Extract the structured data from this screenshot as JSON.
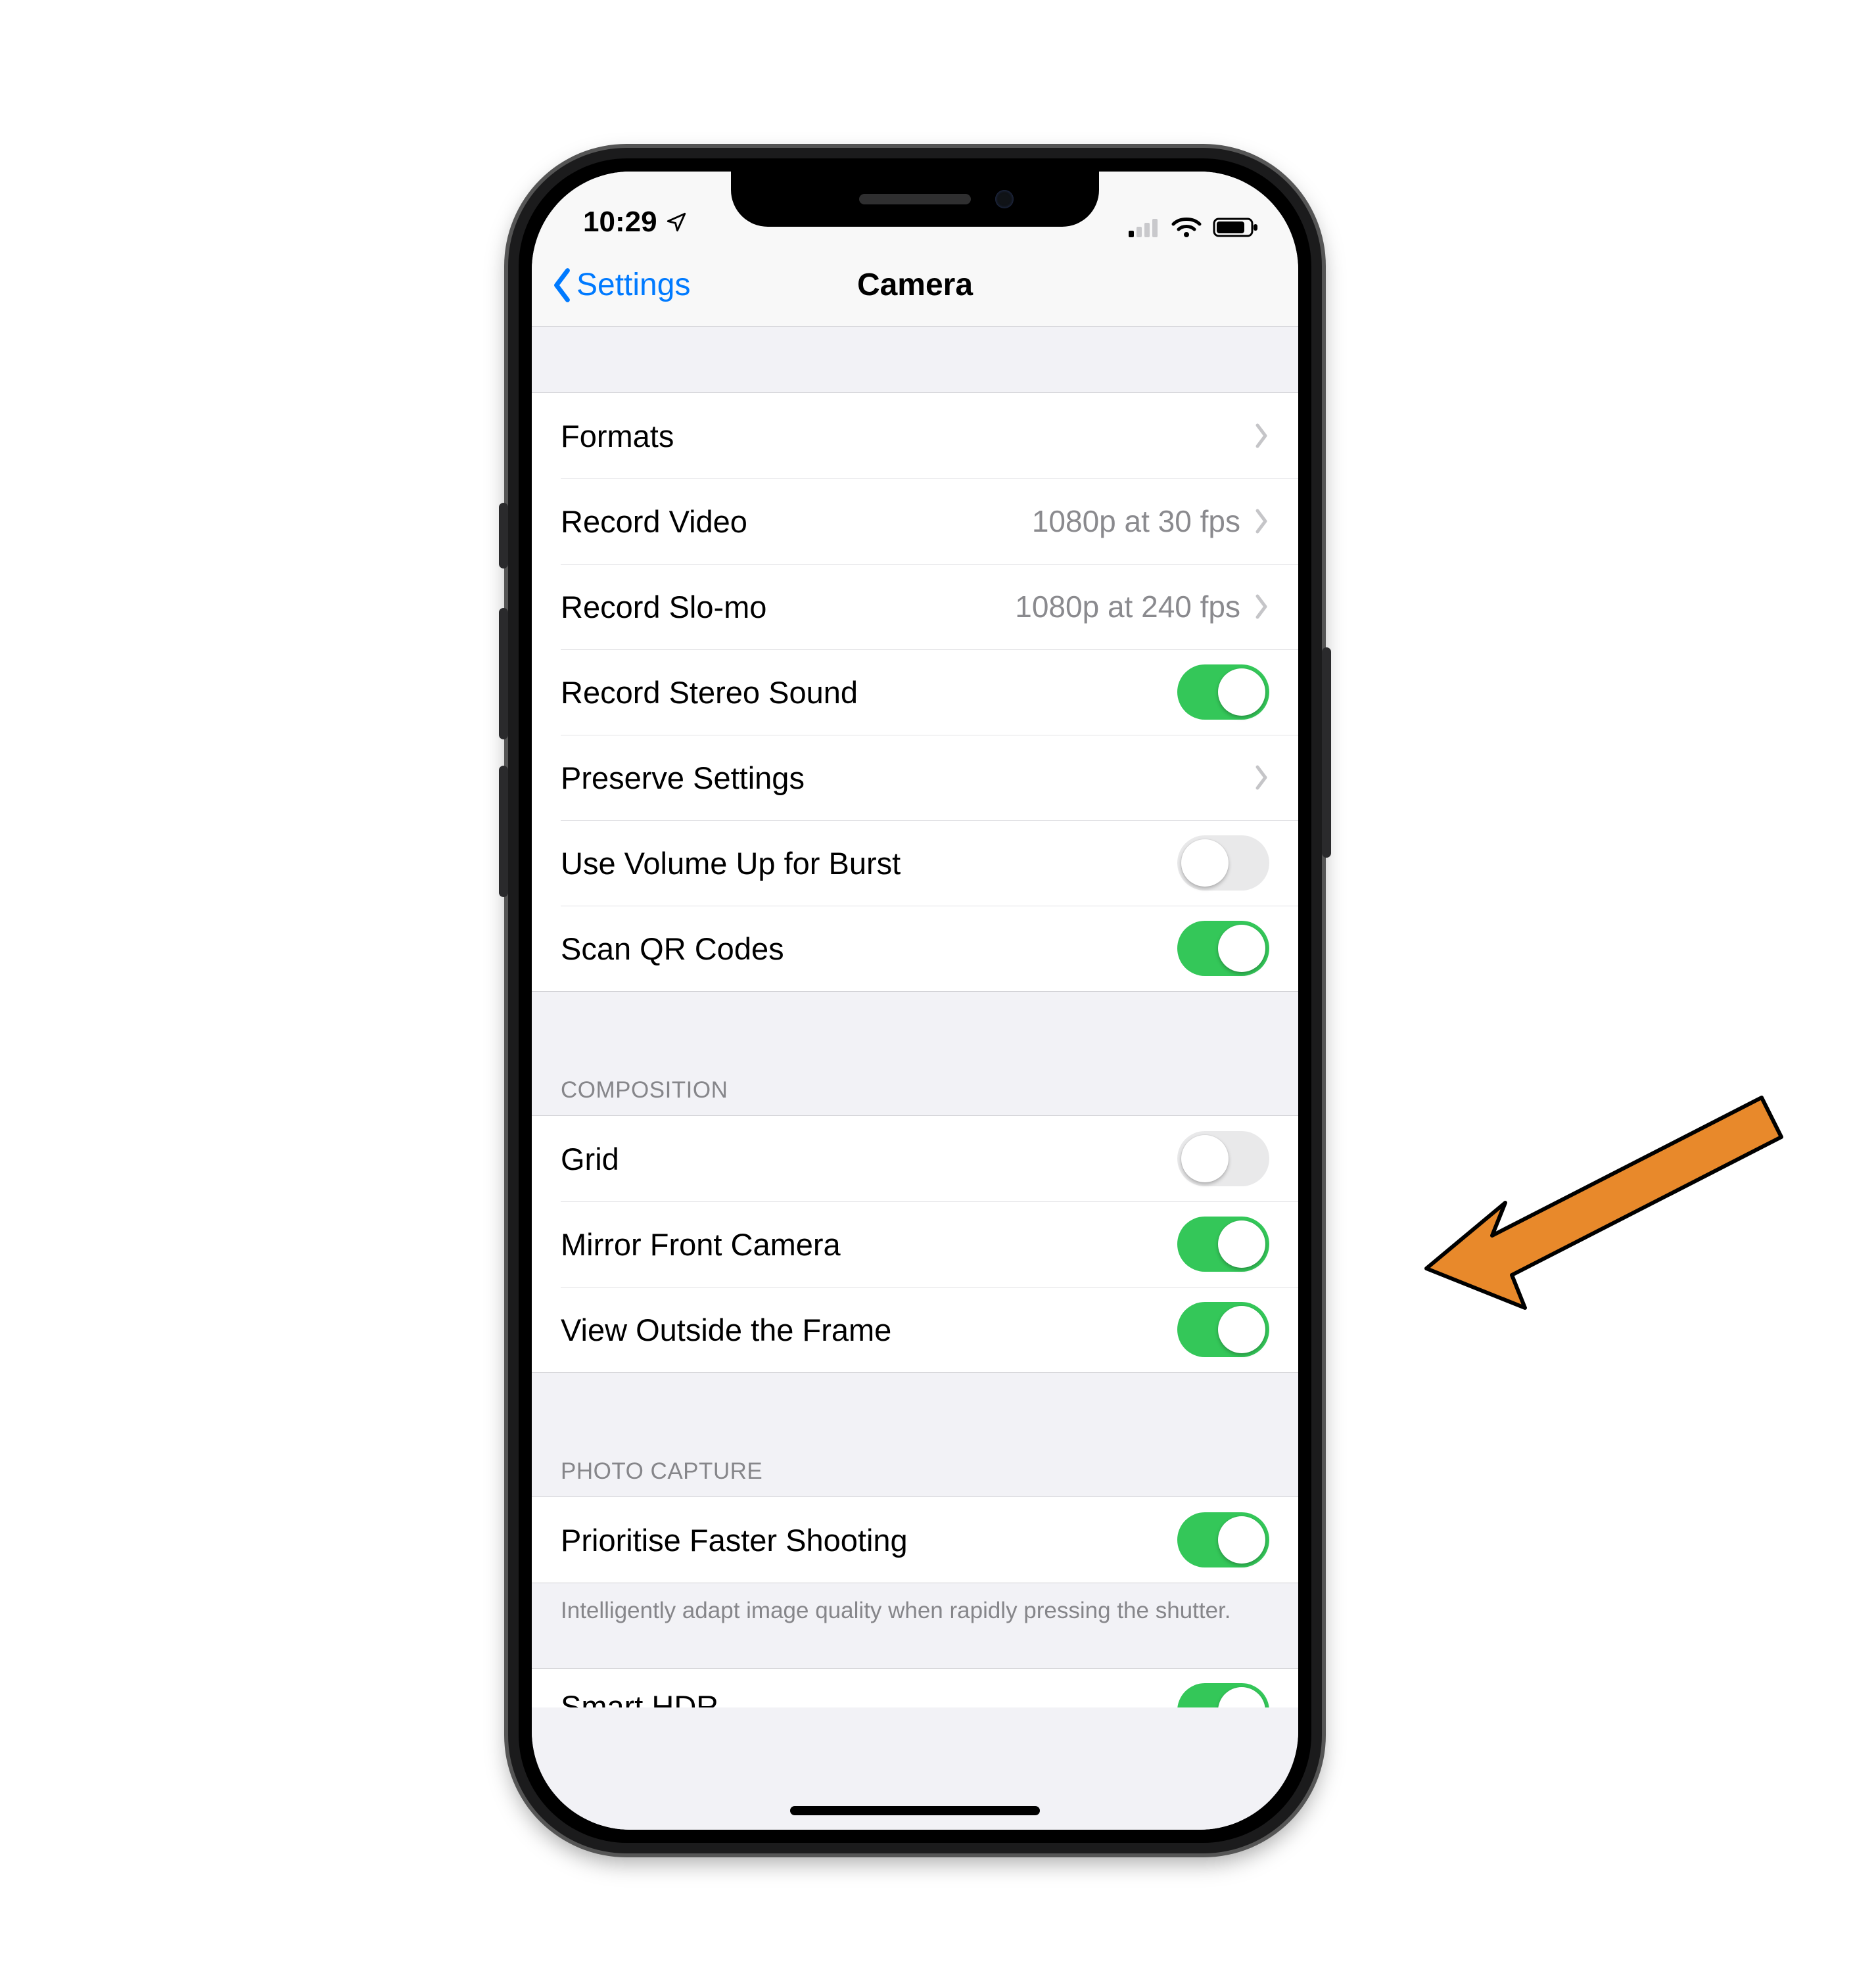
{
  "status_bar": {
    "time": "10:29"
  },
  "nav": {
    "back_label": "Settings",
    "title": "Camera"
  },
  "sections": {
    "main": {
      "formats": {
        "label": "Formats"
      },
      "record_video": {
        "label": "Record Video",
        "detail": "1080p at 30 fps"
      },
      "record_slomo": {
        "label": "Record Slo-mo",
        "detail": "1080p at 240 fps"
      },
      "record_stereo": {
        "label": "Record Stereo Sound",
        "on": true
      },
      "preserve_settings": {
        "label": "Preserve Settings"
      },
      "volume_burst": {
        "label": "Use Volume Up for Burst",
        "on": false
      },
      "scan_qr": {
        "label": "Scan QR Codes",
        "on": true
      }
    },
    "composition": {
      "header": "COMPOSITION",
      "grid": {
        "label": "Grid",
        "on": false
      },
      "mirror": {
        "label": "Mirror Front Camera",
        "on": true
      },
      "view_outside": {
        "label": "View Outside the Frame",
        "on": true
      }
    },
    "photo_capture": {
      "header": "PHOTO CAPTURE",
      "prioritise": {
        "label": "Prioritise Faster Shooting",
        "on": true
      },
      "footer": "Intelligently adapt image quality when rapidly pressing the shutter.",
      "smart_hdr": {
        "label": "Smart HDR",
        "on": true
      }
    }
  },
  "annotation": {
    "arrow_target": "mirror-front-camera-toggle",
    "arrow_color": "#e8892b"
  }
}
